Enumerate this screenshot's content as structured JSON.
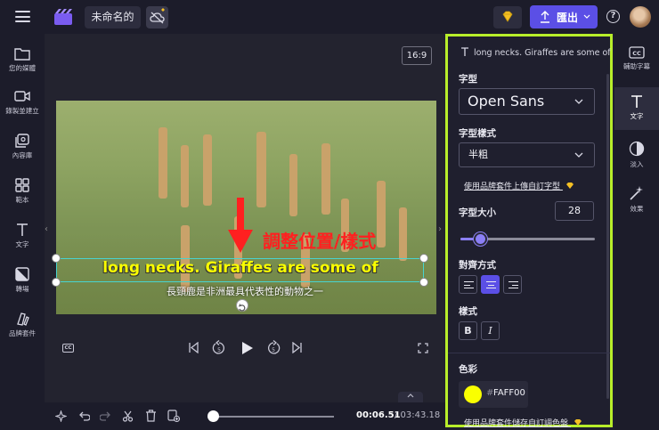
{
  "header": {
    "project_title": "未命名的",
    "export_label": "匯出"
  },
  "left_sidebar": {
    "items": [
      {
        "label": "您的媒體",
        "icon": "folder-icon"
      },
      {
        "label": "錄製並建立",
        "icon": "video-camera-icon"
      },
      {
        "label": "內容庫",
        "icon": "content-library-icon"
      },
      {
        "label": "範本",
        "icon": "templates-icon"
      },
      {
        "label": "文字",
        "icon": "text-icon"
      },
      {
        "label": "轉場",
        "icon": "transitions-icon"
      },
      {
        "label": "品牌套件",
        "icon": "brand-kit-icon"
      }
    ]
  },
  "stage": {
    "aspect_ratio": "16:9",
    "caption_main": "long necks. Giraffes are some of",
    "caption_sub": "長頸鹿是非洲最具代表性的動物之一",
    "annotation": "調整位置/樣式"
  },
  "timeline": {
    "current_time": "00:06.51",
    "total_time": "/ 03:43.18",
    "progress": 0.03
  },
  "panel": {
    "header_text": "long necks. Giraffes are some of",
    "font_label": "字型",
    "font_value": "Open Sans",
    "font_style_label": "字型樣式",
    "font_style_value": "半粗",
    "brand_font_link": "使用品牌套件上傳自訂字型",
    "font_size_label": "字型大小",
    "font_size_value": "28",
    "font_size_fraction": 0.15,
    "alignment_label": "對齊方式",
    "alignment_selected": "center",
    "style_label": "樣式",
    "bold_label": "B",
    "italic_label": "I",
    "color_label": "色彩",
    "color_hash": "#",
    "color_hex": "FAFF00",
    "color_value": "#faff00",
    "brand_palette_link": "使用品牌套件儲存自訂調色盤"
  },
  "right_sidebar": {
    "items": [
      {
        "label": "輔助字幕",
        "icon": "captions-icon",
        "active": false
      },
      {
        "label": "文字",
        "icon": "text-icon",
        "active": true
      },
      {
        "label": "淡入",
        "icon": "fade-icon",
        "active": false
      },
      {
        "label": "效果",
        "icon": "effects-wand-icon",
        "active": false
      }
    ]
  },
  "colors": {
    "accent": "#5b4fe6",
    "highlight_border": "#b8ee2a",
    "caption_color": "#faff00",
    "annotation_color": "#ff2020"
  }
}
